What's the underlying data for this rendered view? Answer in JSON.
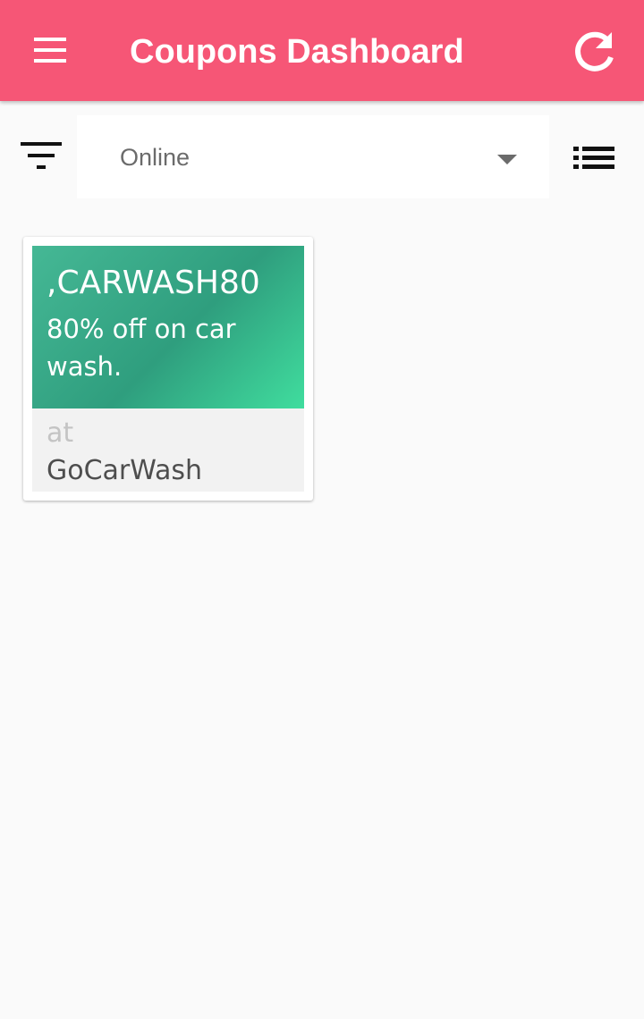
{
  "appbar": {
    "title": "Coupons Dashboard",
    "menu_icon": "hamburger-menu-icon",
    "refresh_icon": "refresh-icon",
    "color": "#f65676"
  },
  "filter": {
    "icon": "filter-icon",
    "selected": "Online",
    "list_view_icon": "list-view-icon"
  },
  "coupons": [
    {
      "code": ",CARWASH80",
      "description": "80% off on car wash.",
      "at_label": "at",
      "store": "GoCarWash",
      "colors": {
        "gradient_start": "#45b895",
        "gradient_end": "#40dd9e"
      }
    }
  ]
}
